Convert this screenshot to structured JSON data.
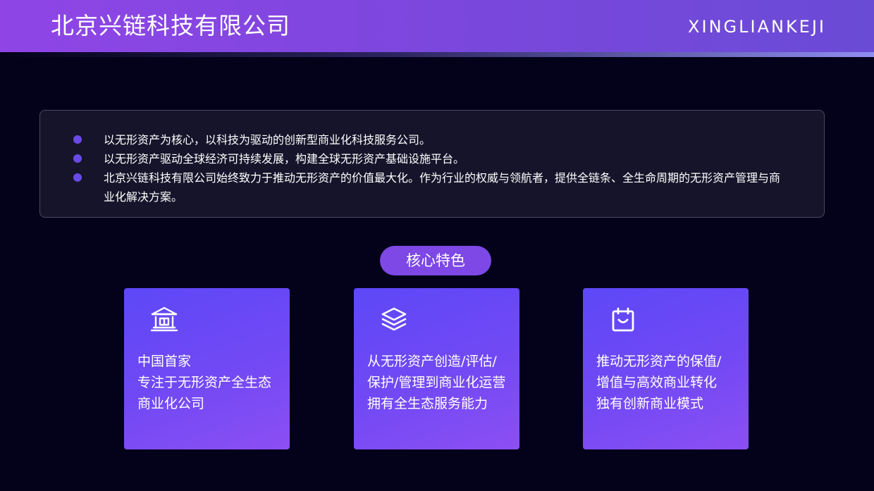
{
  "header": {
    "title": "北京兴链科技有限公司",
    "latin_title": "XINGLIANKEJI"
  },
  "intro": {
    "items": [
      "以无形资产为核心，以科技为驱动的创新型商业化科技服务公司。",
      "以无形资产驱动全球经济可持续发展，构建全球无形资产基础设施平台。",
      "北京兴链科技有限公司始终致力于推动无形资产的价值最大化。作为行业的权威与领航者，提供全链条、全生命周期的无形资产管理与商业化解决方案。"
    ]
  },
  "section": {
    "title": "核心特色"
  },
  "cards": [
    {
      "icon": "bank-icon",
      "lines": [
        "中国首家",
        "专注于无形资产全生态",
        "商业化公司"
      ]
    },
    {
      "icon": "layers-icon",
      "lines": [
        "从无形资产创造/评估/",
        "保护/管理到商业化运营",
        "拥有全生态服务能力"
      ]
    },
    {
      "icon": "calendar-smile-icon",
      "lines": [
        "推动无形资产的保值/",
        "增值与高效商业转化",
        "独有创新商业模式"
      ]
    }
  ],
  "colors": {
    "background": "#03021a",
    "header_start": "#8f45e6",
    "header_end": "#6a4bd6",
    "accent": "#7d48e6",
    "bullet": "#6a4ae6",
    "card_start": "#5d48f7",
    "card_end": "#8c4ff3"
  }
}
